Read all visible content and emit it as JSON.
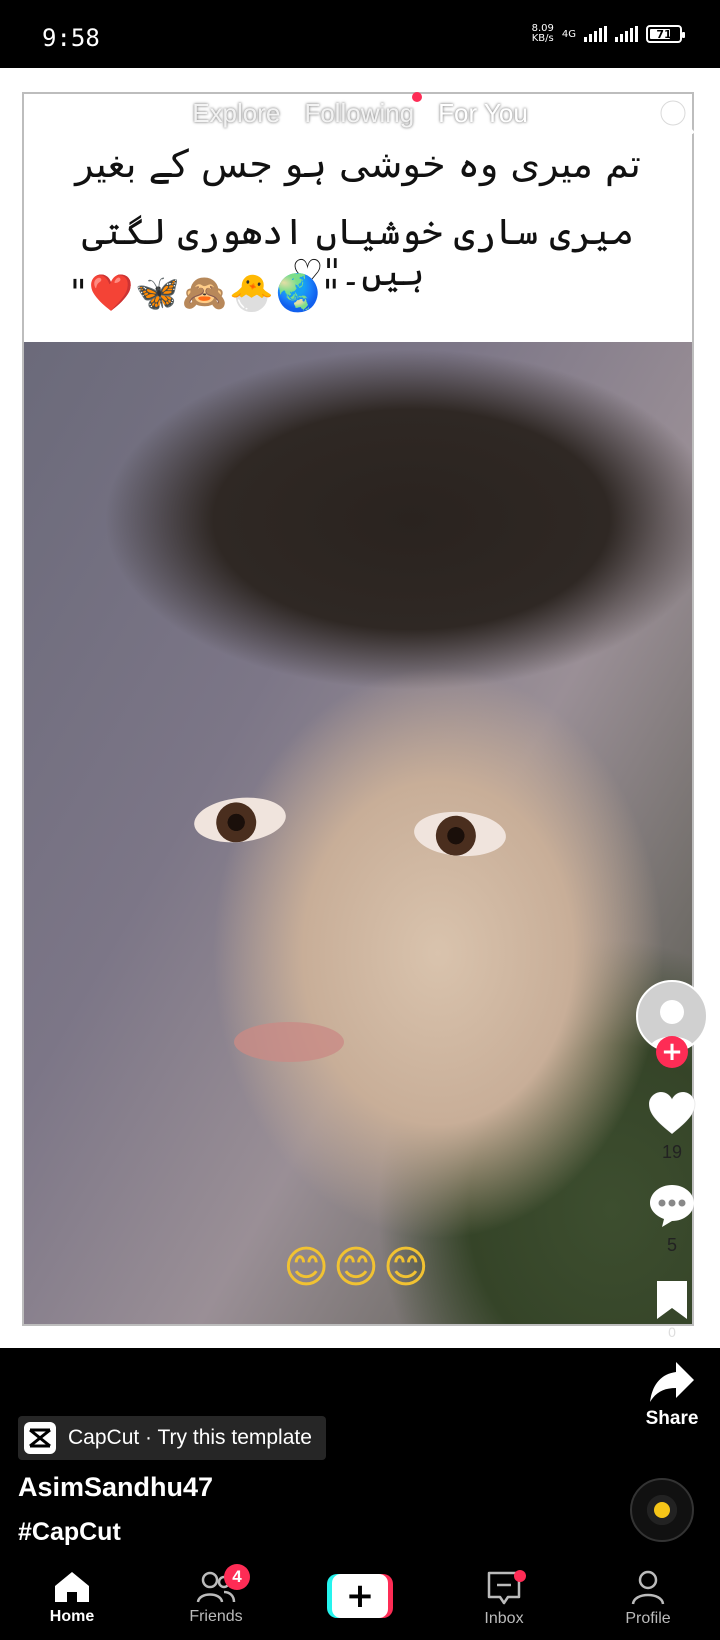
{
  "status_bar": {
    "time": "9:58",
    "net_speed_value": "8.09",
    "net_speed_unit": "KB/s",
    "net_type": "4G",
    "battery_level": "71",
    "battery_fraction": 0.71
  },
  "top_tabs": {
    "explore": "Explore",
    "following": "Following",
    "for_you": "For You"
  },
  "video": {
    "caption_line_1": "تم میری وہ خوشی ہو جس کے بغیر",
    "caption_line_2": "میری ساری خوشیاں ادھوری لگتی ہیں۔\"♡",
    "caption_emojis": "\"❤️🦋🙈🐣🌏\"",
    "overlay_emojis": "😊😊😊"
  },
  "side_actions": {
    "likes": "19",
    "comments": "5",
    "saves": "0",
    "share_label": "Share"
  },
  "post": {
    "template_chip": "CapCut · Try this template",
    "username": "AsimSandhu47",
    "hashtag": "#CapCut"
  },
  "bottom_nav": {
    "home": "Home",
    "friends": "Friends",
    "friends_badge": "4",
    "inbox": "Inbox",
    "profile": "Profile"
  },
  "colors": {
    "accent": "#fe2c55",
    "cyan": "#25f4ee",
    "music_disc_dot": "#f5c518"
  }
}
